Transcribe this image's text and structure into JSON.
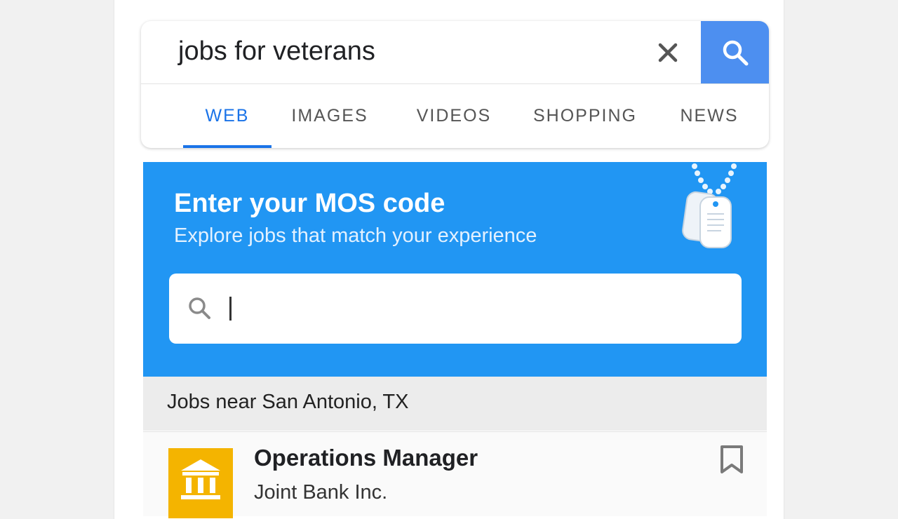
{
  "search": {
    "query": "jobs for veterans",
    "tabs": [
      {
        "label": "WEB",
        "active": true
      },
      {
        "label": "IMAGES",
        "active": false
      },
      {
        "label": "VIDEOS",
        "active": false
      },
      {
        "label": "SHOPPING",
        "active": false
      },
      {
        "label": "NEWS",
        "active": false
      }
    ]
  },
  "mos_card": {
    "title": "Enter your MOS code",
    "subtitle": "Explore jobs that match your experience",
    "input_value": ""
  },
  "jobs": {
    "header": "Jobs near San Antonio, TX",
    "items": [
      {
        "title": "Operations Manager",
        "company": "Joint Bank Inc.",
        "logo_icon": "bank-icon",
        "bookmark_icon": "bookmark-icon"
      }
    ]
  },
  "colors": {
    "accent": "#1a73e8",
    "search_button": "#4d8ff0",
    "mos_card": "#2196f3",
    "job_logo": "#f4b400"
  }
}
